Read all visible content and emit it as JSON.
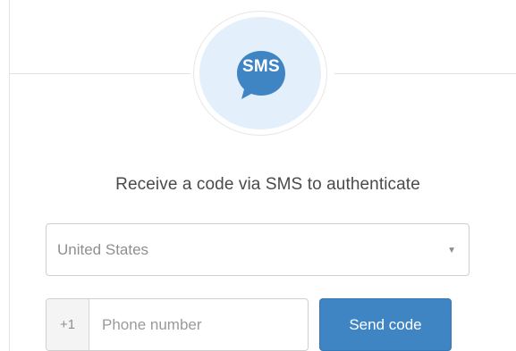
{
  "header": {
    "icon": "sms-chat-bubble-icon",
    "icon_text": "SMS",
    "icon_color": "#3f85c4",
    "icon_background": "#e3effb"
  },
  "prompt": "Receive a code via SMS to authenticate",
  "country_select": {
    "selected": "United States"
  },
  "phone": {
    "dial_code": "+1",
    "placeholder": "Phone number",
    "value": ""
  },
  "send_button": {
    "label": "Send code",
    "color": "#3f85c4"
  }
}
